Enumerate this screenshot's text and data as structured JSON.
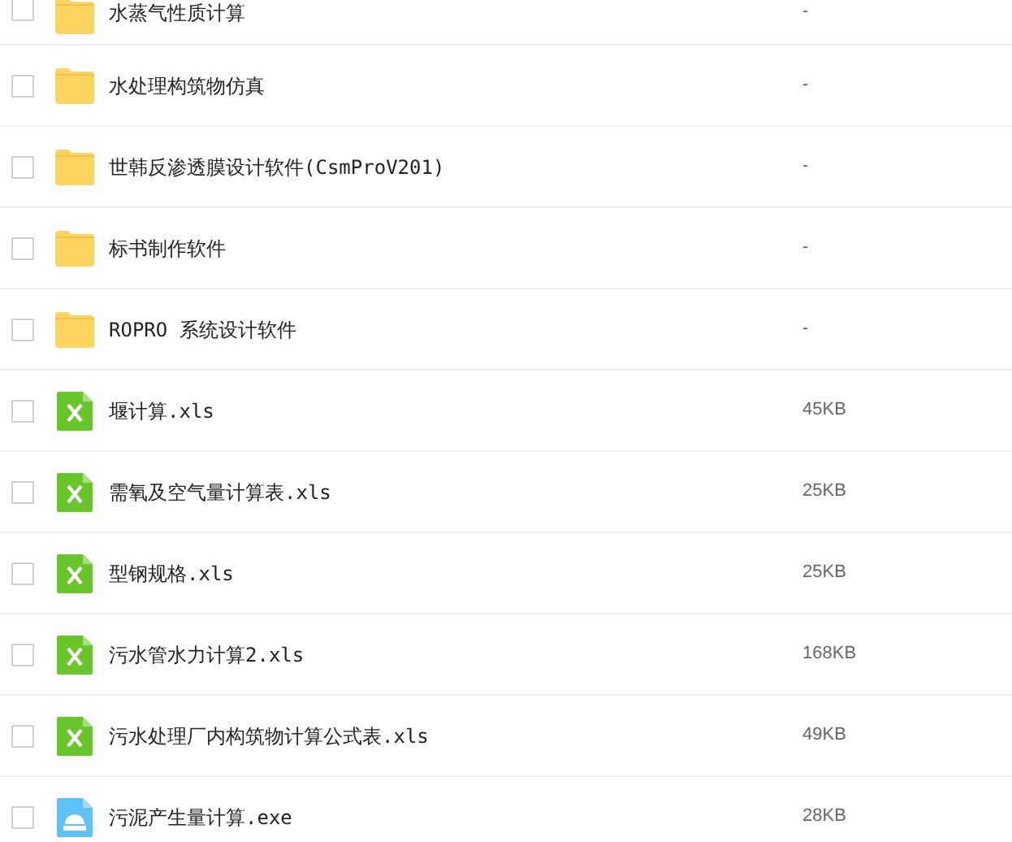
{
  "files": [
    {
      "name": "水蒸气性质计算",
      "kind": "folder",
      "size": "-",
      "checked": false
    },
    {
      "name": "水处理构筑物仿真",
      "kind": "folder",
      "size": "-",
      "checked": false
    },
    {
      "name": "世韩反渗透膜设计软件(CsmProV201)",
      "kind": "folder",
      "size": "-",
      "checked": false
    },
    {
      "name": "标书制作软件",
      "kind": "folder",
      "size": "-",
      "checked": false
    },
    {
      "name": "ROPRO 系统设计软件",
      "kind": "folder",
      "size": "-",
      "checked": false
    },
    {
      "name": "堰计算.xls",
      "kind": "xls",
      "size": "45KB",
      "checked": false
    },
    {
      "name": "需氧及空气量计算表.xls",
      "kind": "xls",
      "size": "25KB",
      "checked": false
    },
    {
      "name": "型钢规格.xls",
      "kind": "xls",
      "size": "25KB",
      "checked": false
    },
    {
      "name": "污水管水力计算2.xls",
      "kind": "xls",
      "size": "168KB",
      "checked": false
    },
    {
      "name": "污水处理厂内构筑物计算公式表.xls",
      "kind": "xls",
      "size": "49KB",
      "checked": false
    },
    {
      "name": "污泥产生量计算.exe",
      "kind": "exe",
      "size": "28KB",
      "checked": false
    }
  ]
}
